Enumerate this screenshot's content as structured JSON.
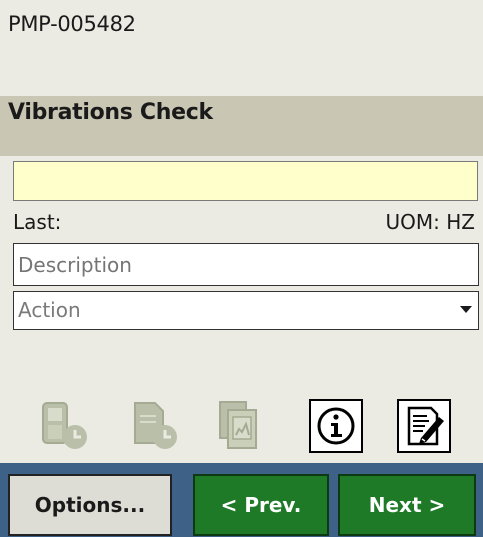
{
  "header": {
    "asset_id": "PMP-005482"
  },
  "title_bar": {
    "title": "Vibrations Check"
  },
  "reading": {
    "value": ""
  },
  "info_row": {
    "last_label": "Last:",
    "uom_label": "UOM: HZ"
  },
  "description": {
    "placeholder": "Description",
    "value": ""
  },
  "action": {
    "placeholder": "Action"
  },
  "toolbar": {
    "icons": [
      {
        "name": "device-history-icon",
        "enabled": false
      },
      {
        "name": "document-history-icon",
        "enabled": false
      },
      {
        "name": "multi-document-icon",
        "enabled": false
      },
      {
        "name": "info-icon",
        "enabled": true
      },
      {
        "name": "notes-edit-icon",
        "enabled": true
      }
    ]
  },
  "buttons": {
    "options_label": "Options...",
    "prev_label": "< Prev.",
    "next_label": "Next >"
  },
  "colors": {
    "background": "#ecebe3",
    "title_bar": "#c9c6b3",
    "reading_field": "#ffffcc",
    "bottom_bar": "#3e6287",
    "nav_button": "#1f7a28"
  }
}
